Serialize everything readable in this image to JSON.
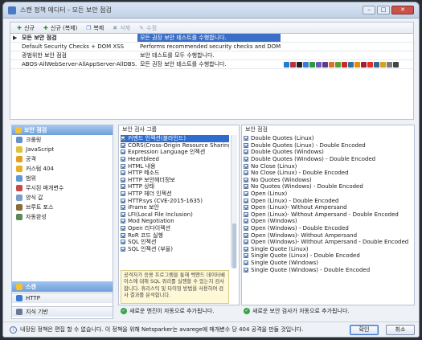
{
  "window": {
    "title": "스캔 정책 에디터 - 모든 보안 점검"
  },
  "toolbar": {
    "new": "신규",
    "new_clone": "신규 (복제)",
    "copy": "복제",
    "delete": "삭제",
    "edit": "수정"
  },
  "policies": [
    {
      "name": "모든 보안 점검",
      "description": "모든 권장 보안 테스트를 수행합니다.",
      "selected": true
    },
    {
      "name": "Default Security Checks + DOM XSS",
      "description": "Performs recommended security checks and DOM ..."
    },
    {
      "name": "광범위한 보안 점검",
      "description": "보안 테스트를 모두 수행합니다."
    },
    {
      "name": "ABOS-AllWebServer-AllAppServer-AllDBS...",
      "description": "모든 권장 보안 테스트를 수행합니다."
    }
  ],
  "sidebar": {
    "header": "보안 점검",
    "items": [
      "크롤링",
      "JavaScript",
      "공격",
      "커스텀 404",
      "범위",
      "무시된 매개변수",
      "양식 값",
      "브루트 포스",
      "자동완성"
    ],
    "bottom": [
      "스캔",
      "HTTP",
      "지식 기반"
    ]
  },
  "groups_panel": {
    "title": "보안 검사 그룹",
    "items": [
      "커맨드 인젝션(블라인드)",
      "CORS(Cross-Origin Resource Sharing)",
      "Expression Language 인젝션",
      "Heartbleed",
      "HTML 내용",
      "HTTP 메소드",
      "HTTP 보안헤더정보",
      "HTTP 상태",
      "HTTP 헤더 인젝션",
      "HTTP.sys (CVE-2015-1635)",
      "iFrame 보안",
      "LFI(Local File Inclusion)",
      "Mod Negotiation",
      "Open 리다이렉션",
      "RoR 코드 실행",
      "SQL 인젝션",
      "SQL 인젝션 (부울)"
    ],
    "highlighted_index": 0,
    "description": "공격자가 응용 프로그램을 통해 백엔드 데이터베이스에 대해 SQL 쿼리를 실행할 수 있는지 검사합니다. 휴리스틱 및 타이밍 방법을 사용하여 검사 결과를 분석합니다.",
    "status": "새로운 엔진이 자동으로 추가됩니다."
  },
  "checks_panel": {
    "title": "보안 점검",
    "items": [
      "Double Quotes (Linux)",
      "Double Quotes (Linux) - Double Encoded",
      "Double Quotes (Windows)",
      "Double Quotes (Windows) - Double Encoded",
      "No Close (Linux)",
      "No Close (Linux) - Double Encoded",
      "No Quotes (Windows)",
      "No Quotes (Windows) - Double Encoded",
      "Open (Linux)",
      "Open (Linux) - Double Encoded",
      "Open (Linux)- Without Ampersand",
      "Open (Linux)- Without Ampersand - Double Encoded",
      "Open (Windows)",
      "Open (Windows) - Double Encoded",
      "Open (Windows)- Without Ampersand",
      "Open (Windows)- Without Ampersand - Double Encoded",
      "Single Quote (Linux)",
      "Single Quote (Linux) - Double Encoded",
      "Single Quote (Windows)",
      "Single Quote (Windows) - Double Encoded"
    ],
    "status": "새로운 보안 검사가 자동으로 추가됩니다."
  },
  "footer": {
    "message": "내장된 정책은 편집 할 수 없습니다. 이 정책을 위해 Netsparker는 avarege에 매개변수 당 404 공격을 만들 것입니다.",
    "ok": "확인",
    "cancel": "취소"
  },
  "colors": {
    "accent": "#3b6fc7",
    "header": "#6f9fd8",
    "ok": "#3aa34a"
  }
}
